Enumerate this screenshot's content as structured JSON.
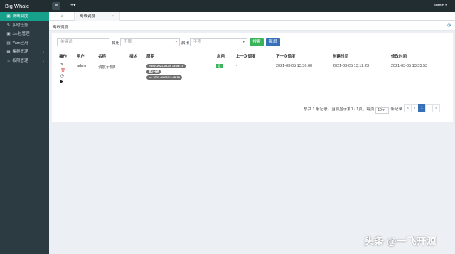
{
  "topbar": {
    "brand": "Big Whale",
    "toggle_icon": "≡",
    "add_label": "+▾",
    "user": "admin ▾"
  },
  "sidebar": {
    "items": [
      {
        "icon": "▣",
        "label": "离线调度",
        "active": true
      },
      {
        "icon": "✎",
        "label": "实时任务"
      },
      {
        "icon": "▣",
        "label": "Jar包管理"
      },
      {
        "icon": "▤",
        "label": "Yarn应用"
      },
      {
        "icon": "▦",
        "label": "集群管理",
        "chevron": "‹"
      },
      {
        "icon": "⌂",
        "label": "权限管理",
        "chevron": "‹"
      }
    ]
  },
  "tabs": {
    "home_icon": "⌂",
    "active_tab": "离线调度",
    "close": "×"
  },
  "breadcrumb": {
    "title": "离线调度",
    "refresh_icon": "⟳"
  },
  "filters": {
    "keyword_placeholder": "关键词",
    "enable1_label": "启用",
    "enable1_value": "不限",
    "enable2_label": "启用",
    "enable2_value": "不限",
    "search_button": "搜索",
    "new_button": "新增"
  },
  "table": {
    "headers": [
      "操作",
      "用户",
      "名称",
      "描述",
      "周期",
      "启用",
      "上一次调度",
      "下一次调度",
      "创建时间",
      "修改时间"
    ],
    "row": {
      "ops": [
        "✎",
        "🗑",
        "◷",
        "▶"
      ],
      "user": "admin",
      "name": "调度示例1",
      "description": "",
      "cycle": [
        "from: 2021-03-05 13:05:19",
        "每2分钟",
        "to: 2021-03-03 13:05:19"
      ],
      "enabled": "是",
      "last_run": "-",
      "next_run": "2021-03-05 13:36:00",
      "created": "2021-03-05 13:12:23",
      "modified": "2021-03-05 13:35:53"
    }
  },
  "pagination": {
    "summary_prefix": "总共 1 条记录，当前显示第1 / 1页，每页",
    "page_size": "10",
    "summary_suffix": "条记录",
    "buttons": [
      "«",
      "‹",
      "1",
      "›",
      "»"
    ]
  },
  "watermark": "头条 @一飞开源",
  "colors": {
    "topbar": "#222d32",
    "sidebar": "#2c3b41",
    "active": "#17a08b",
    "search": "#3bb35b",
    "primary": "#3570b8"
  }
}
